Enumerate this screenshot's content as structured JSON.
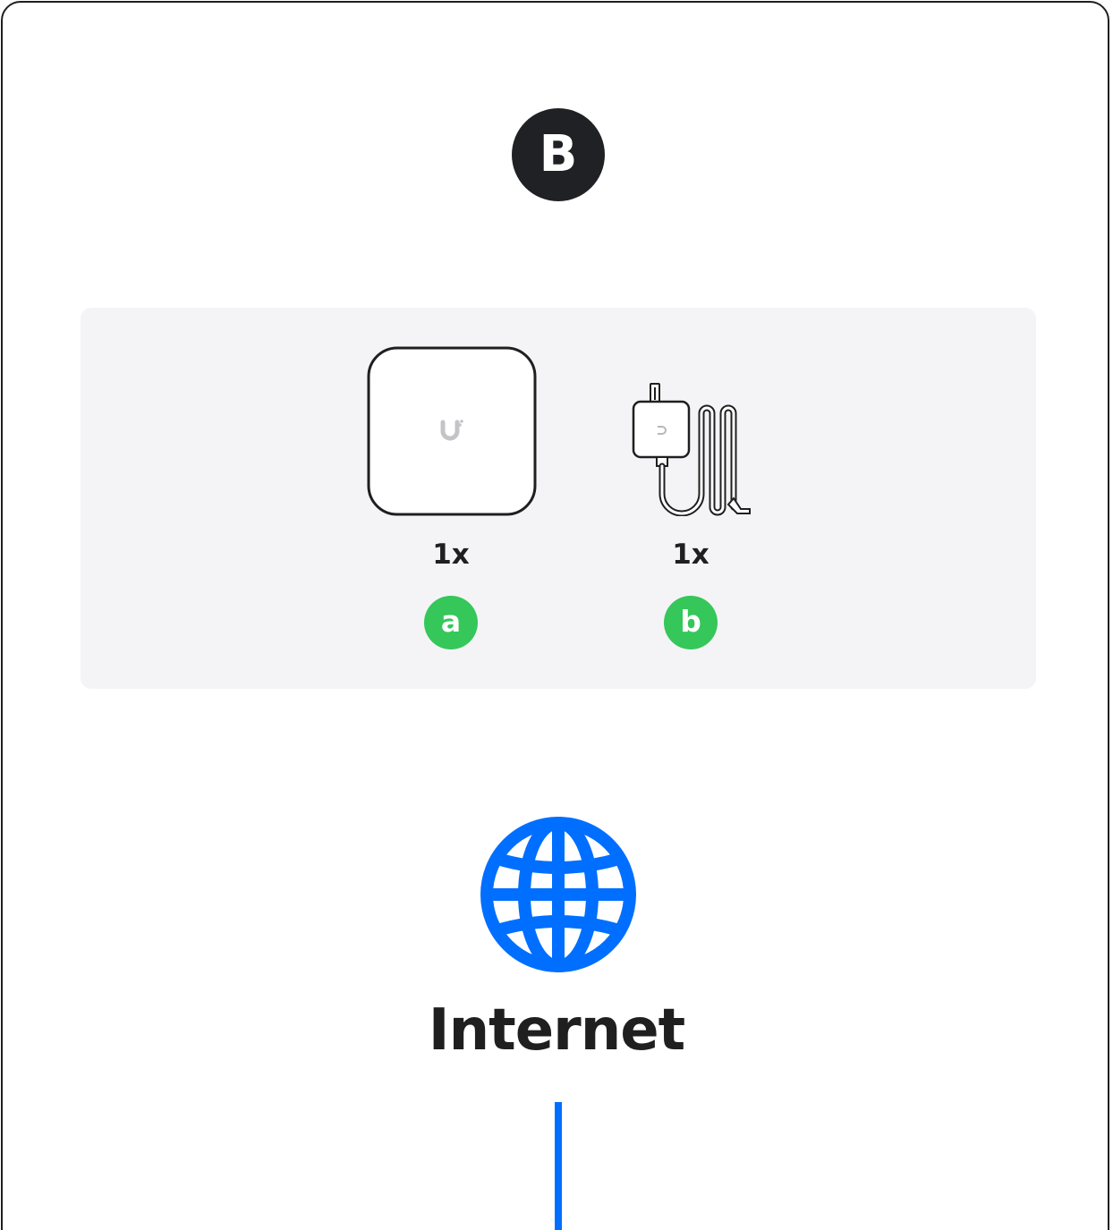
{
  "step": {
    "label": "B"
  },
  "package_contents": {
    "items": [
      {
        "quantity": "1x",
        "letter": "a",
        "icon": "device-icon"
      },
      {
        "quantity": "1x",
        "letter": "b",
        "icon": "power-adapter-icon"
      }
    ]
  },
  "internet": {
    "icon": "globe-icon",
    "label": "Internet"
  },
  "colors": {
    "badge": "#202124",
    "letter_badge": "#35c759",
    "accent_blue": "#006fff",
    "panel": "#f4f4f6"
  }
}
